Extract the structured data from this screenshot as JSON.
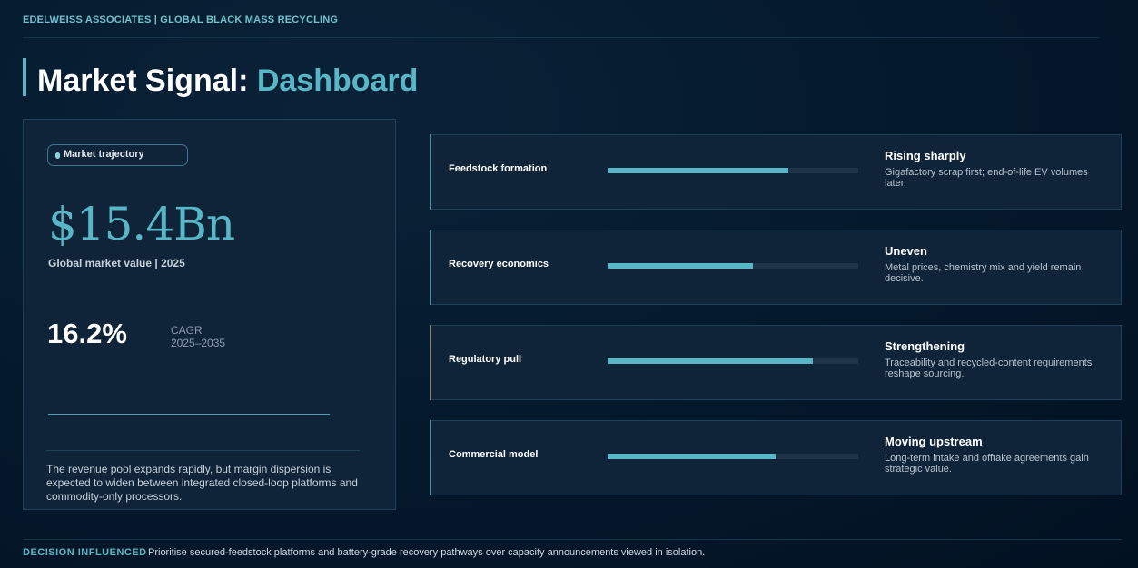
{
  "header": {
    "eyebrow": "EDELWEISS ASSOCIATES | GLOBAL BLACK MASS RECYCLING",
    "title_main": "Market Signal: ",
    "title_accent": "Dashboard"
  },
  "left_card": {
    "pill_label": "Market trajectory",
    "market_value": "$15.4Bn",
    "market_caption": "Global market value | 2025",
    "cagr_value": "16.2%",
    "cagr_label_line1": "CAGR",
    "cagr_label_line2": "2025–2035",
    "description": "The revenue pool expands rapidly, but margin dispersion is expected to widen between integrated closed-loop platforms and commodity-only processors."
  },
  "signals": [
    {
      "label": "Feedstock formation",
      "level": 0.72,
      "status": "Rising sharply",
      "note": "Gigafactory scrap first; end-of-life EV volumes later."
    },
    {
      "label": "Recovery economics",
      "level": 0.58,
      "status": "Uneven",
      "note": "Metal prices, chemistry mix and yield remain decisive."
    },
    {
      "label": "Regulatory pull",
      "level": 0.82,
      "status": "Strengthening",
      "note": "Traceability and recycled-content requirements reshape sourcing."
    },
    {
      "label": "Commercial model",
      "level": 0.67,
      "status": "Moving upstream",
      "note": "Long-term intake and offtake agreements gain strategic value."
    }
  ],
  "footer": {
    "decision_label": "DECISION INFLUENCED",
    "decision_text": "Prioritise secured-feedstock platforms and battery-grade recovery pathways over capacity announcements viewed in isolation."
  },
  "colors": {
    "accent": "#57b7c6",
    "background": "#031426",
    "card": "#0f2339"
  }
}
